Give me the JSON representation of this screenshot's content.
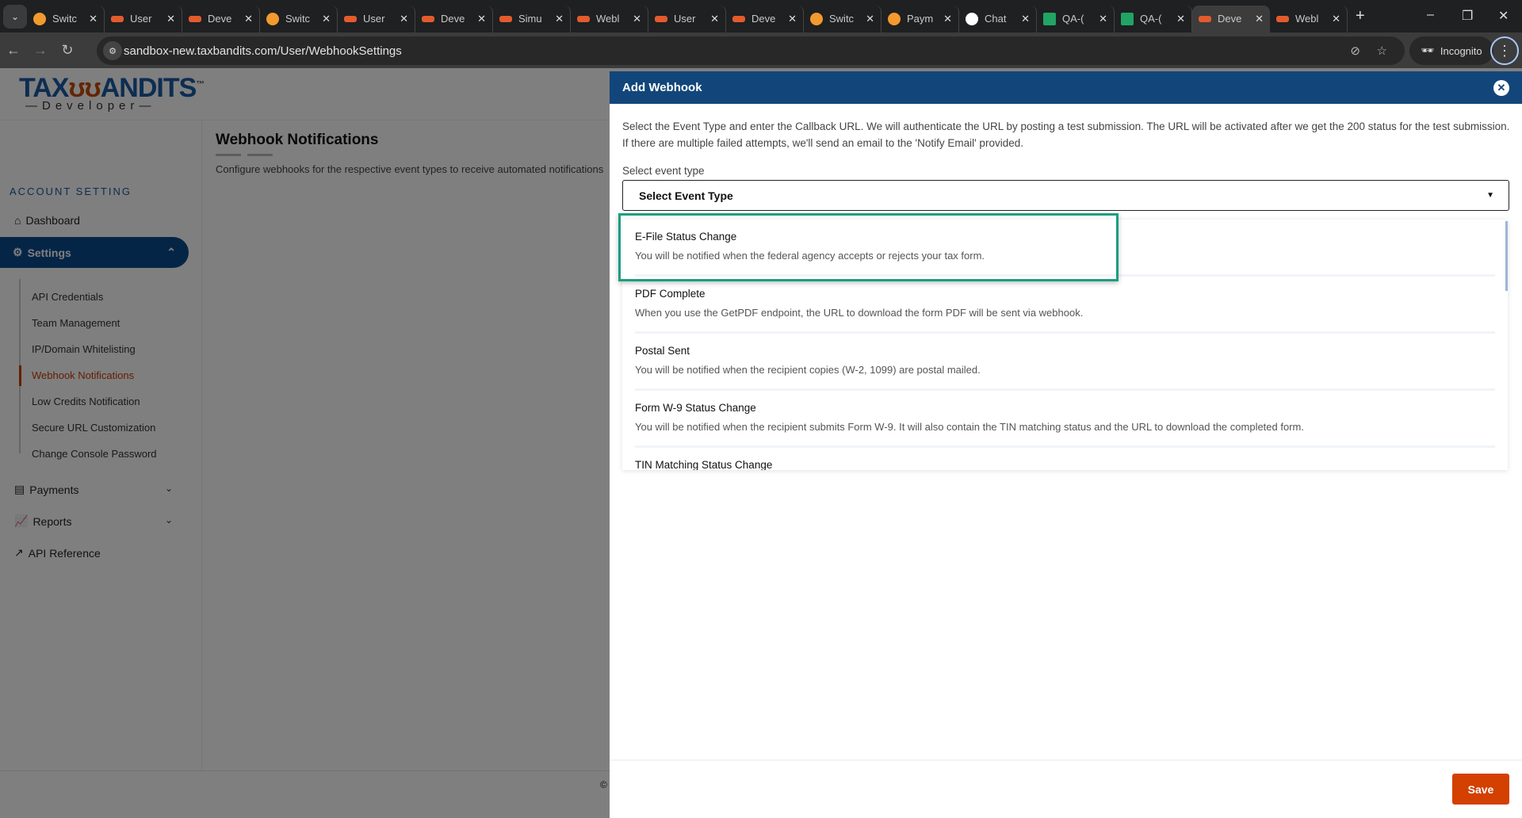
{
  "browser": {
    "tabs": [
      {
        "label": "Switc",
        "icon": "orange-icon"
      },
      {
        "label": "User",
        "icon": "taxbandits-icon"
      },
      {
        "label": "Deve",
        "icon": "taxbandits-icon"
      },
      {
        "label": "Switc",
        "icon": "orange-icon"
      },
      {
        "label": "User",
        "icon": "taxbandits-icon"
      },
      {
        "label": "Deve",
        "icon": "taxbandits-icon"
      },
      {
        "label": "Simu",
        "icon": "taxbandits-icon"
      },
      {
        "label": "Webl",
        "icon": "taxbandits-icon"
      },
      {
        "label": "User",
        "icon": "taxbandits-icon"
      },
      {
        "label": "Deve",
        "icon": "taxbandits-icon"
      },
      {
        "label": "Switc",
        "icon": "orange-icon"
      },
      {
        "label": "Paym",
        "icon": "orange-icon"
      },
      {
        "label": "Chat",
        "icon": "chatgpt-icon"
      },
      {
        "label": "QA-(",
        "icon": "sheets-icon"
      },
      {
        "label": "QA-(",
        "icon": "sheets-icon"
      },
      {
        "label": "Deve",
        "icon": "taxbandits-icon",
        "active": true
      },
      {
        "label": "Webl",
        "icon": "taxbandits-icon"
      }
    ],
    "url": "sandbox-new.taxbandits.com/User/WebhookSettings",
    "incognito": "Incognito"
  },
  "logo": {
    "brand": "TAXBANDITS",
    "sub": "Developer"
  },
  "sidebar": {
    "section": "ACCOUNT SETTING",
    "dashboard": "Dashboard",
    "settings": "Settings",
    "sub_items": [
      "API Credentials",
      "Team Management",
      "IP/Domain Whitelisting",
      "Webhook Notifications",
      "Low Credits Notification",
      "Secure URL Customization",
      "Change Console Password"
    ],
    "active_sub": "Webhook Notifications",
    "payments": "Payments",
    "reports": "Reports",
    "api_reference": "API Reference"
  },
  "main": {
    "title": "Webhook Notifications",
    "description": "Configure webhooks for the respective event types to receive automated notifications",
    "copyright": "©"
  },
  "panel": {
    "title": "Add Webhook",
    "intro": "Select the Event Type and enter the Callback URL. We will authenticate the URL by posting a test submission. The URL will be activated after we get the 200 status for the test submission. If there are multiple failed attempts, we'll send an email to the 'Notify Email' provided.",
    "select_label": "Select event type",
    "select_value": "Select Event Type",
    "options": [
      {
        "title": "E-File Status Change",
        "desc": "You will be notified when the federal agency accepts or rejects your tax form."
      },
      {
        "title": "PDF Complete",
        "desc": "When you use the GetPDF endpoint, the URL to download the form PDF will be sent via webhook."
      },
      {
        "title": "Postal Sent",
        "desc": "You will be notified when the recipient copies (W-2, 1099) are postal mailed."
      },
      {
        "title": "Form W-9 Status Change",
        "desc": "You will be notified when the recipient submits Form W-9. It will also contain the TIN matching status and the URL to download the completed form."
      },
      {
        "title": "TIN Matching Status Change",
        "desc": ""
      }
    ],
    "save": "Save"
  },
  "colors": {
    "header": "#12467a",
    "accent": "#d34000",
    "highlight": "#1a9e80",
    "nav": "#0a4a8f"
  }
}
